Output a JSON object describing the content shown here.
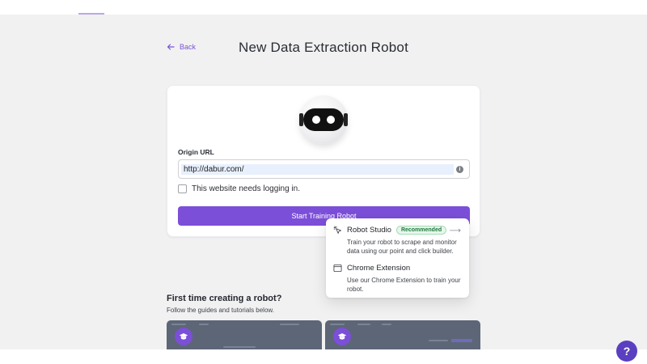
{
  "header": {
    "back_label": "Back",
    "title": "New Data Extraction Robot"
  },
  "form": {
    "origin_label": "Origin URL",
    "origin_value": "http://dabur.com/",
    "login_label": "This website needs logging in.",
    "start_label": "Start Training Robot"
  },
  "dropdown": {
    "items": [
      {
        "title": "Robot Studio",
        "badge": "Recommended",
        "description": "Train your robot to scrape and monitor data using our point and click builder.",
        "icon": "cursor-click-icon"
      },
      {
        "title": "Chrome Extension",
        "description": "Use our Chrome Extension to train your robot.",
        "icon": "browser-window-icon"
      }
    ]
  },
  "tutorials": {
    "title": "First time creating a robot?",
    "subtitle": "Follow the guides and tutorials below."
  },
  "help": {
    "label": "?"
  },
  "colors": {
    "accent": "#7c4fd8",
    "page_bg": "#f1f1f2",
    "badge_green": "#1c7a3b"
  }
}
